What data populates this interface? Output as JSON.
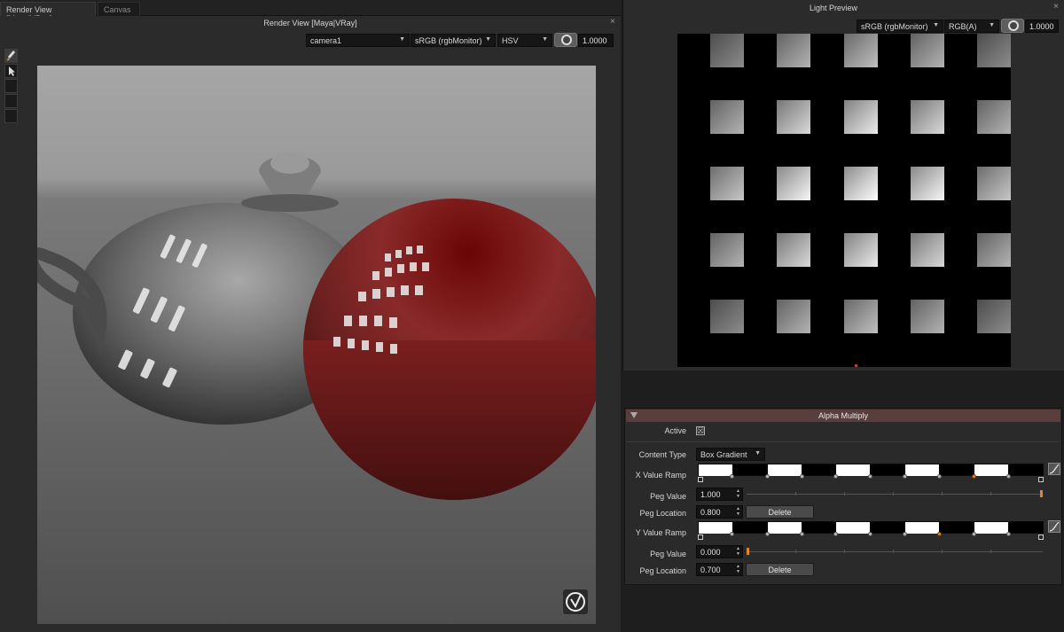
{
  "tabs": {
    "active": "Render View [Maya|VRay]",
    "inactive": "Canvas"
  },
  "render_view": {
    "title": "Render View [Maya|VRay]",
    "camera": "camera1",
    "colorspace": "sRGB (rgbMonitor)",
    "channel_mode": "HSV",
    "exposure": "1.0000",
    "logo_label": "V-Ray logo"
  },
  "light_preview": {
    "title": "Light Preview",
    "colorspace": "sRGB (rgbMonitor)",
    "channel": "RGB(A)",
    "exposure": "1.0000",
    "grid_brightness": [
      [
        0.55,
        0.7,
        0.75,
        0.7,
        0.55
      ],
      [
        0.7,
        0.85,
        0.92,
        0.85,
        0.7
      ],
      [
        0.78,
        0.97,
        1.0,
        0.97,
        0.78
      ],
      [
        0.7,
        0.85,
        0.92,
        0.85,
        0.7
      ],
      [
        0.55,
        0.7,
        0.75,
        0.7,
        0.55
      ]
    ]
  },
  "alpha_multiply": {
    "title": "Alpha Multiply",
    "active_label": "Active",
    "active_checked": "☒",
    "content_type_label": "Content Type",
    "content_type_value": "Box Gradient",
    "x_ramp_label": "X Value Ramp",
    "x_peg_value_label": "Peg Value",
    "x_peg_value": "1.000",
    "x_peg_location_label": "Peg Location",
    "x_peg_location": "0.800",
    "x_delete": "Delete",
    "x_peg_slider_level": 1.0,
    "y_ramp_label": "Y Value Ramp",
    "y_peg_value_label": "Peg Value",
    "y_peg_value": "0.000",
    "y_peg_location_label": "Peg Location",
    "y_peg_location": "0.700",
    "y_delete": "Delete",
    "y_peg_slider_level": 0.0
  },
  "colors": {
    "accent": "#e0862a",
    "header": "#5a3d3d"
  }
}
